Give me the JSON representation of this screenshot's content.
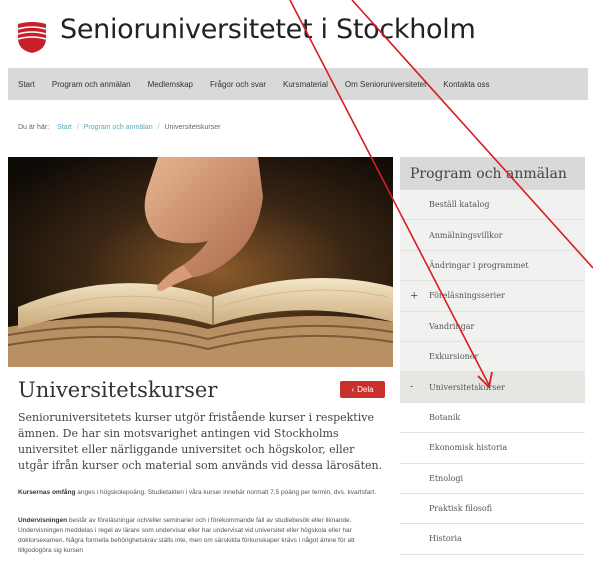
{
  "header": {
    "site_name": "Senioruniversitetet i Stockholm"
  },
  "nav": {
    "items": [
      "Start",
      "Program och anmälan",
      "Medlemskap",
      "Frågor och svar",
      "Kursmaterial",
      "Om Senioruniversitetet",
      "Kontakta oss"
    ]
  },
  "breadcrumb": {
    "prefix": "Du är här:",
    "items": [
      "Start",
      "Program och anmälan",
      "Universitetskurser"
    ]
  },
  "content": {
    "title": "Universitetskurser",
    "share_label": "Dela",
    "lead": "Senioruniversitetets kurser utgör fristående kurser i respektive ämnen. De har sin motsvarighet antingen vid Stockholms universitet eller närliggande universitet och högskolor, eller utgår ifrån kurser och material som används vid dessa lärosäten.",
    "p1_bold": "Kursernas omfång",
    "p1_text": " anges i högskolepoäng. Studietakten i våra kurser innebär normalt 7,5 poäng per termin, dvs. kvartsfart.",
    "p2_bold": "Undervisningen",
    "p2_text": " består av föreläsningar och/eller seminarier och i förekommande fall av studiebesök eller liknande. Undervisningen meddelas i regel av lärare som undervisar eller har undervisat vid universitet eller högskola eller har doktorsexamen. Några formella behörighetskrav ställs inte, men om särskilda förkunskaper krävs i något ämne för att tillgodogöra sig kursen"
  },
  "sidebar": {
    "title": "Program och anmälan",
    "items": [
      {
        "label": "Beställ katalog",
        "level": 1,
        "toggle": ""
      },
      {
        "label": "Anmälningsvillkor",
        "level": 1,
        "toggle": ""
      },
      {
        "label": "Ändringar i programmet",
        "level": 1,
        "toggle": ""
      },
      {
        "label": "Föreläsningsserier",
        "level": 1,
        "toggle": "+"
      },
      {
        "label": "Vandringar",
        "level": 1,
        "toggle": ""
      },
      {
        "label": "Exkursioner",
        "level": 1,
        "toggle": ""
      },
      {
        "label": "Universitetskurser",
        "level": 1,
        "toggle": "-",
        "active": true
      },
      {
        "label": "Botanik",
        "level": 2,
        "toggle": ""
      },
      {
        "label": "Ekonomisk historia",
        "level": 2,
        "toggle": ""
      },
      {
        "label": "Etnologi",
        "level": 2,
        "toggle": ""
      },
      {
        "label": "Praktisk filosofi",
        "level": 2,
        "toggle": ""
      },
      {
        "label": "Historia",
        "level": 2,
        "toggle": ""
      }
    ]
  },
  "colors": {
    "accent_red": "#c9302c",
    "nav_bg": "#d9d9d9",
    "link": "#5aa6b8",
    "annotation": "#d81c24"
  }
}
